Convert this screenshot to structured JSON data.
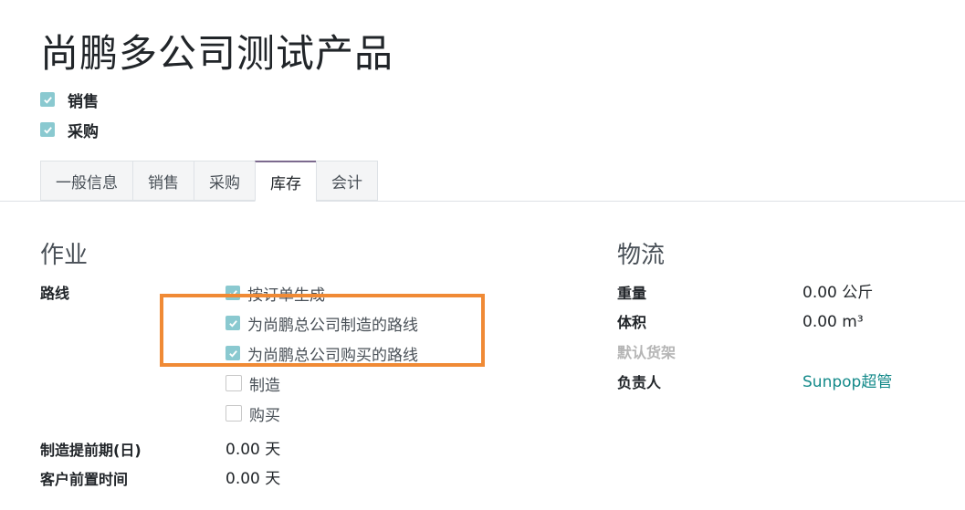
{
  "product": {
    "name": "尚鹏多公司测试产品",
    "options": [
      {
        "label": "销售",
        "checked": true
      },
      {
        "label": "采购",
        "checked": true
      }
    ]
  },
  "tabs": [
    {
      "label": "一般信息",
      "active": false
    },
    {
      "label": "销售",
      "active": false
    },
    {
      "label": "采购",
      "active": false
    },
    {
      "label": "库存",
      "active": true
    },
    {
      "label": "会计",
      "active": false
    }
  ],
  "operations": {
    "title": "作业",
    "routes_label": "路线",
    "routes": [
      {
        "label": "按订单生成",
        "checked": true
      },
      {
        "label": "为尚鹏总公司制造的路线",
        "checked": true
      },
      {
        "label": "为尚鹏总公司购买的路线",
        "checked": true
      },
      {
        "label": "制造",
        "checked": false
      },
      {
        "label": "购买",
        "checked": false
      }
    ],
    "manufacture_lead_label": "制造提前期(日)",
    "manufacture_lead_value": "0.00 天",
    "customer_lead_label": "客户前置时间",
    "customer_lead_value": "0.00 天"
  },
  "logistics": {
    "title": "物流",
    "weight_label": "重量",
    "weight_value": "0.00 公斤",
    "volume_label": "体积",
    "volume_value": "0.00 m³",
    "default_shelf_label": "默认货架",
    "responsible_label": "负责人",
    "responsible_value": "Sunpop超管"
  },
  "colors": {
    "checkbox": "#8ac9d0",
    "tab_accent": "#7c6a8e",
    "link": "#148a8a",
    "highlight": "#f08a35"
  }
}
